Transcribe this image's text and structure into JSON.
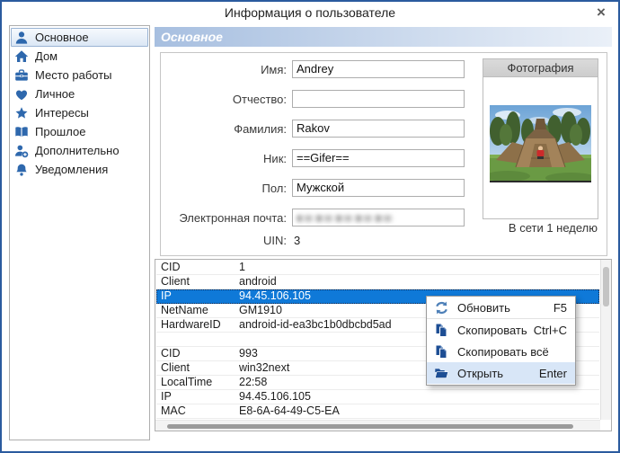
{
  "window": {
    "title": "Информация о пользователе",
    "close_glyph": "×"
  },
  "sidebar": {
    "items": [
      {
        "label": "Основное",
        "icon": "person-icon",
        "selected": true
      },
      {
        "label": "Дом",
        "icon": "home-icon"
      },
      {
        "label": "Место работы",
        "icon": "briefcase-icon"
      },
      {
        "label": "Личное",
        "icon": "heart-icon"
      },
      {
        "label": "Интересы",
        "icon": "star-icon"
      },
      {
        "label": "Прошлое",
        "icon": "book-icon"
      },
      {
        "label": "Дополнительно",
        "icon": "person-add-icon"
      },
      {
        "label": "Уведомления",
        "icon": "bell-icon"
      }
    ]
  },
  "main": {
    "section_title": "Основное",
    "form": {
      "fields": [
        {
          "label": "Имя:",
          "value": "Andrey"
        },
        {
          "label": "Отчество:",
          "value": ""
        },
        {
          "label": "Фамилия:",
          "value": "Rakov"
        },
        {
          "label": "Ник:",
          "value": "==Gifer=="
        },
        {
          "label": "Пол:",
          "value": "Мужской"
        },
        {
          "label": "Электронная почта:",
          "value": "",
          "masked": true
        }
      ],
      "uin_label": "UIN:",
      "uin_value": "3"
    },
    "photo": {
      "title": "Фотография",
      "status": "В сети 1 неделю"
    },
    "table": {
      "rows": [
        {
          "key": "CID",
          "value": "1"
        },
        {
          "key": "Client",
          "value": "android"
        },
        {
          "key": "IP",
          "value": "94.45.106.105",
          "selected": true
        },
        {
          "key": "NetName",
          "value": "GM1910"
        },
        {
          "key": "HardwareID",
          "value": "android-id-ea3bc1b0dbcbd5ad"
        },
        {
          "key": "",
          "value": ""
        },
        {
          "key": "CID",
          "value": "993"
        },
        {
          "key": "Client",
          "value": "win32next"
        },
        {
          "key": "LocalTime",
          "value": "22:58"
        },
        {
          "key": "IP",
          "value": "94.45.106.105"
        },
        {
          "key": "MAC",
          "value": "E8-6A-64-49-C5-EA"
        }
      ]
    }
  },
  "context_menu": {
    "items": [
      {
        "label": "Обновить",
        "shortcut": "F5",
        "icon": "refresh-icon",
        "separator_after": true
      },
      {
        "label": "Скопировать",
        "shortcut": "Ctrl+C",
        "icon": "copy-icon"
      },
      {
        "label": "Скопировать всё",
        "shortcut": "",
        "icon": "copy-icon"
      },
      {
        "label": "Открыть",
        "shortcut": "Enter",
        "icon": "open-folder-icon",
        "highlighted": true
      }
    ]
  },
  "colors": {
    "window_border": "#2b5b9e",
    "selection_blue": "#0f79d8",
    "sidebar_icon_blue": "#2e68ad",
    "menu_icon_blue": "#1d4e94",
    "section_header_gradient_start": "#a7bfe0",
    "section_header_gradient_end": "#eaf0f8",
    "menu_highlight": "#d8e6f7"
  }
}
